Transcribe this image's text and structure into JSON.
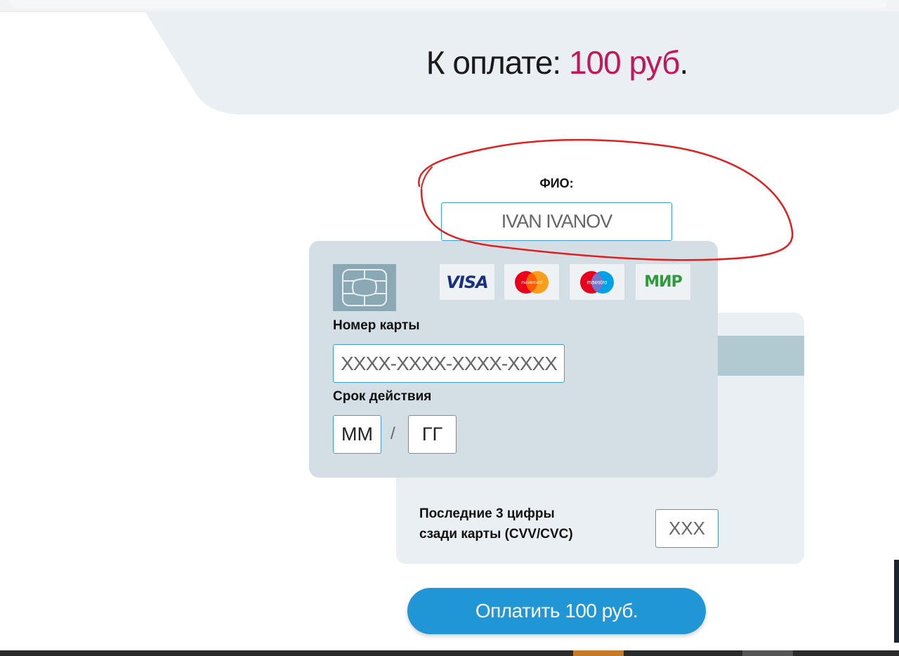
{
  "header": {
    "title_prefix": "К оплате",
    "title_colon": ":",
    "amount": "100 руб",
    "title_suffix": "."
  },
  "fio": {
    "label": "ФИО:",
    "value": "IVAN IVANOV"
  },
  "card": {
    "brands": [
      "VISA",
      "mastercard",
      "maestro",
      "МИР"
    ],
    "number_label": "Номер карты",
    "number_placeholder": "XXXX-XXXX-XXXX-XXXX",
    "expiry_label": "Срок действия",
    "month_placeholder": "ММ",
    "separator": "/",
    "year_placeholder": "ГГ",
    "cvv_label_line1": "Последние 3 цифры",
    "cvv_label_line2": "сзади карты (CVV/CVC)",
    "cvv_placeholder": "XXX"
  },
  "pay_button": {
    "label": "Оплатить 100 руб."
  },
  "colors": {
    "amount": "#c2185b",
    "button": "#2196d6",
    "input_border": "#3fa0d3",
    "card_front": "#d3dfe4",
    "card_back": "#e9eff2",
    "annotation": "#e02020"
  },
  "annotation": {
    "type": "red-freehand-ellipse",
    "around": "fio"
  }
}
